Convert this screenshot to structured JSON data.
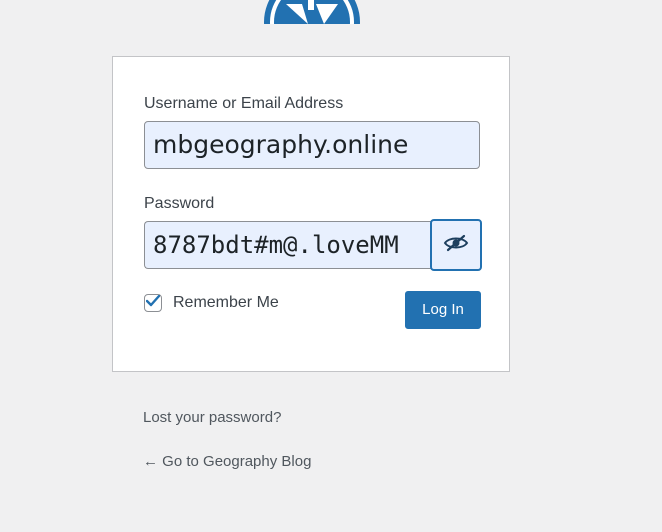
{
  "logo": {
    "icon": "wordpress-logo-icon",
    "color": "#2271b1"
  },
  "form": {
    "username_label": "Username or Email Address",
    "username_value": "mbgeography.online",
    "password_label": "Password",
    "password_value": "8787bdt#m@.loveMM",
    "toggle_password_icon": "eye-slash-icon",
    "remember_label": "Remember Me",
    "remember_checked": true,
    "submit_label": "Log In"
  },
  "links": {
    "lost_password": "Lost your password?",
    "back_to_blog": "← Go to Geography Blog"
  },
  "colors": {
    "accent": "#2271b1",
    "input_fill": "#e8f0fe",
    "page_background": "#f0f0f1"
  }
}
